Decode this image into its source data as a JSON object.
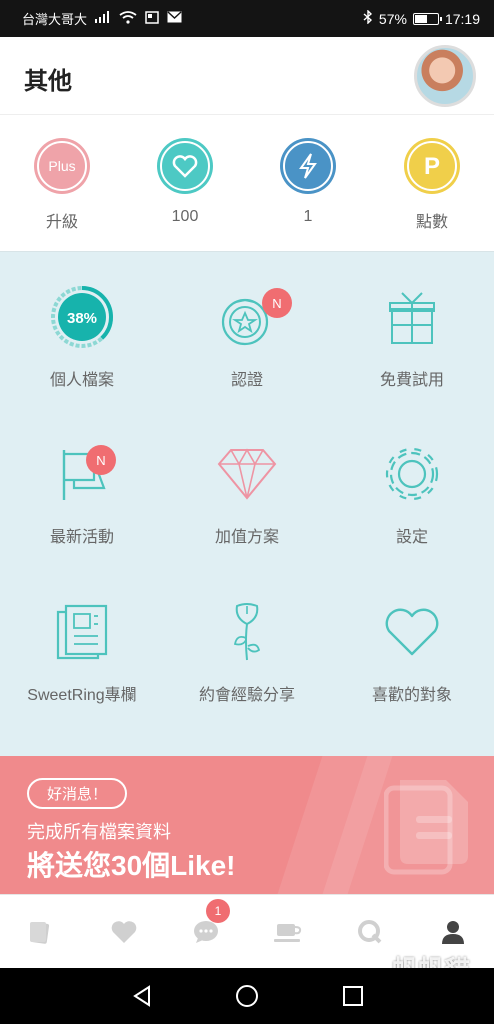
{
  "status_bar": {
    "carrier": "台灣大哥大",
    "battery": "57%",
    "battery_level": 0.57,
    "time": "17:19"
  },
  "header": {
    "title": "其他"
  },
  "stats": [
    {
      "icon": "plus-upgrade-icon",
      "icon_text": "Plus",
      "label": "升級",
      "color": "#efa3a9"
    },
    {
      "icon": "heart-icon",
      "label": "100",
      "color": "#4dc9c4"
    },
    {
      "icon": "lightning-icon",
      "label": "1",
      "color": "#4a93c6"
    },
    {
      "icon": "points-icon",
      "icon_text": "P",
      "label": "點數",
      "color": "#f0cf4a"
    }
  ],
  "grid": [
    {
      "icon": "profile-progress-icon",
      "progress_text": "38%",
      "progress": 0.38,
      "label": "個人檔案"
    },
    {
      "icon": "medal-icon",
      "badge": "N",
      "label": "認證"
    },
    {
      "icon": "gift-icon",
      "label": "免費試用"
    },
    {
      "icon": "flag-icon",
      "badge": "N",
      "label": "最新活動"
    },
    {
      "icon": "diamond-icon",
      "label": "加值方案"
    },
    {
      "icon": "gear-icon",
      "label": "設定"
    },
    {
      "icon": "newspaper-icon",
      "label": "SweetRing專欄"
    },
    {
      "icon": "rose-icon",
      "label": "約會經驗分享"
    },
    {
      "icon": "heart-outline-icon",
      "label": "喜歡的對象"
    }
  ],
  "banner": {
    "pill": "好消息！",
    "line1": "完成所有檔案資料",
    "line2": "將送您30個Like!"
  },
  "tabbar": {
    "chat_badge": "1",
    "watermark": "帆帆貓"
  },
  "colors": {
    "teal": "#4dc3bd",
    "pink": "#f08a8c",
    "grid_bg": "#e0eff3"
  }
}
